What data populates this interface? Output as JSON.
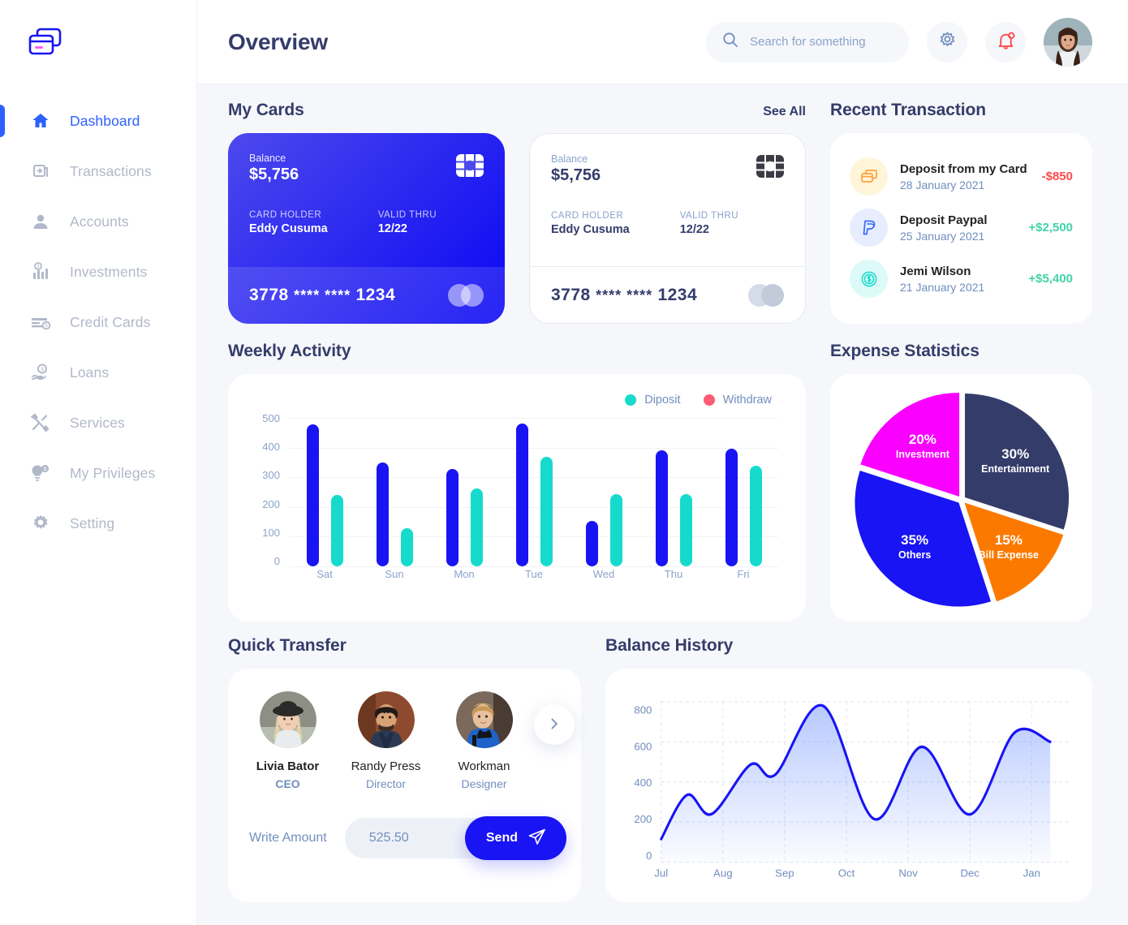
{
  "app": {
    "logo_name": "stacked-cards-logo",
    "accent_blue": "#1814f3",
    "nav_blue": "#2d60ff",
    "title_navy": "#343c6a",
    "muted_blue": "#718ebf"
  },
  "sidebar": {
    "items": [
      {
        "label": "Dashboard",
        "icon": "home-icon",
        "active": true
      },
      {
        "label": "Transactions",
        "icon": "transfer-icon",
        "active": false
      },
      {
        "label": "Accounts",
        "icon": "user-icon",
        "active": false
      },
      {
        "label": "Investments",
        "icon": "investment-chart-icon",
        "active": false
      },
      {
        "label": "Credit Cards",
        "icon": "credit-card-icon",
        "active": false
      },
      {
        "label": "Loans",
        "icon": "hand-money-icon",
        "active": false
      },
      {
        "label": "Services",
        "icon": "tools-icon",
        "active": false
      },
      {
        "label": "My Privileges",
        "icon": "privilege-icon",
        "active": false
      },
      {
        "label": "Setting",
        "icon": "gear-icon",
        "active": false
      }
    ]
  },
  "header": {
    "title": "Overview",
    "search_placeholder": "Search for something",
    "search_value": "",
    "settings_icon": "gear-icon",
    "notification_icon": "bell-icon",
    "has_notification": true,
    "avatar": "user-avatar"
  },
  "my_cards": {
    "title": "My Cards",
    "see_all": "See All",
    "cards": [
      {
        "theme": "blue",
        "balance_label": "Balance",
        "balance": "$5,756",
        "holder_label": "CARD HOLDER",
        "holder": "Eddy Cusuma",
        "valid_label": "VALID THRU",
        "valid": "12/22",
        "number_prefix": "3778",
        "number_mask": "**** ****",
        "number_suffix": "1234"
      },
      {
        "theme": "white",
        "balance_label": "Balance",
        "balance": "$5,756",
        "holder_label": "CARD HOLDER",
        "holder": "Eddy Cusuma",
        "valid_label": "VALID THRU",
        "valid": "12/22",
        "number_prefix": "3778",
        "number_mask": "**** ****",
        "number_suffix": "1234"
      }
    ]
  },
  "recent_transaction": {
    "title": "Recent Transaction",
    "items": [
      {
        "icon": "card-deposit-icon",
        "icon_bg": "#fff5d9",
        "icon_color": "#ff9f38",
        "name": "Deposit from my Card",
        "date": "28 January 2021",
        "amount": "-$850",
        "amount_color": "#ff4b4a"
      },
      {
        "icon": "paypal-icon",
        "icon_bg": "#e7edff",
        "icon_color": "#396aff",
        "name": "Deposit Paypal",
        "date": "25 January 2021",
        "amount": "+$2,500",
        "amount_color": "#41d4a8"
      },
      {
        "icon": "dollar-coin-icon",
        "icon_bg": "#dcfaf8",
        "icon_color": "#16dbcc",
        "name": "Jemi Wilson",
        "date": "21 January 2021",
        "amount": "+$5,400",
        "amount_color": "#41d4a8"
      }
    ]
  },
  "weekly_activity": {
    "title": "Weekly Activity"
  },
  "expense_statistics": {
    "title": "Expense Statistics"
  },
  "quick_transfer": {
    "title": "Quick Transfer",
    "contacts": [
      {
        "name": "Livia Bator",
        "role": "CEO",
        "active": true
      },
      {
        "name": "Randy Press",
        "role": "Director",
        "active": false
      },
      {
        "name": "Workman",
        "role": "Designer",
        "active": false
      }
    ],
    "next_icon": "chevron-right-icon",
    "amount_label": "Write Amount",
    "amount_value": "525.50",
    "amount_placeholder": "525.50",
    "send_label": "Send",
    "send_icon": "paper-plane-icon"
  },
  "balance_history": {
    "title": "Balance History"
  },
  "chart_data": [
    {
      "type": "bar",
      "title": "Weekly Activity",
      "categories": [
        "Sat",
        "Sun",
        "Mon",
        "Tue",
        "Wed",
        "Thu",
        "Fri"
      ],
      "series": [
        {
          "name": "Diposit",
          "color": "#1814f3",
          "values": [
            478,
            350,
            328,
            480,
            153,
            390,
            395
          ]
        },
        {
          "name": "Withdraw",
          "color": "#16dbcc",
          "values": [
            240,
            128,
            262,
            370,
            242,
            242,
            338
          ]
        }
      ],
      "legend": [
        {
          "label": "Diposit",
          "color": "#16dbcc"
        },
        {
          "label": "Withdraw",
          "color": "#fe5c73"
        }
      ],
      "ylabel": "",
      "xlabel": "",
      "yticks": [
        500,
        400,
        300,
        200,
        100,
        0
      ],
      "ylim": [
        0,
        500
      ],
      "legend_position": "top-right",
      "grid": true
    },
    {
      "type": "pie",
      "title": "Expense Statistics",
      "slices": [
        {
          "label": "Entertainment",
          "value": 30,
          "display": "30%",
          "color": "#343c6a"
        },
        {
          "label": "Bill Expense",
          "value": 15,
          "display": "15%",
          "color": "#fc7900"
        },
        {
          "label": "Others",
          "value": 35,
          "display": "35%",
          "color": "#1814f3"
        },
        {
          "label": "Investment",
          "value": 20,
          "display": "20%",
          "color": "#fa00ff"
        }
      ],
      "exploded": true,
      "legend_position": "inside-labels"
    },
    {
      "type": "area",
      "title": "Balance History",
      "x": [
        "Jul",
        "Aug",
        "Sep",
        "Oct",
        "Nov",
        "Dec",
        "Jan"
      ],
      "xtick_labels": [
        "Jul",
        "Aug",
        "Sep",
        "Oct",
        "Nov",
        "Dec",
        "Jan"
      ],
      "yticks": [
        800,
        600,
        400,
        200,
        0
      ],
      "ylim": [
        0,
        800
      ],
      "line_color": "#1814f3",
      "fill": "gradient-blue",
      "grid": true,
      "values": [
        115,
        335,
        240,
        487,
        437,
        780,
        215,
        575,
        238,
        645,
        600
      ],
      "series": [
        {
          "name": "Balance",
          "color": "#1814f3",
          "points": [
            {
              "x": 0.0,
              "y": 115
            },
            {
              "x": 0.42,
              "y": 335
            },
            {
              "x": 0.82,
              "y": 240
            },
            {
              "x": 1.45,
              "y": 487
            },
            {
              "x": 1.85,
              "y": 437
            },
            {
              "x": 2.62,
              "y": 780
            },
            {
              "x": 3.45,
              "y": 215
            },
            {
              "x": 4.22,
              "y": 575
            },
            {
              "x": 5.0,
              "y": 238
            },
            {
              "x": 5.72,
              "y": 645
            },
            {
              "x": 6.3,
              "y": 600
            }
          ]
        }
      ]
    }
  ]
}
